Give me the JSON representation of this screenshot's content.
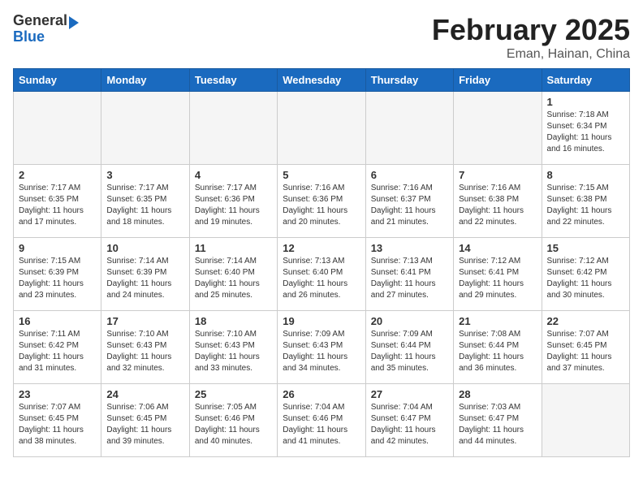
{
  "logo": {
    "line1": "General",
    "line2": "Blue"
  },
  "title": "February 2025",
  "subtitle": "Eman, Hainan, China",
  "days_of_week": [
    "Sunday",
    "Monday",
    "Tuesday",
    "Wednesday",
    "Thursday",
    "Friday",
    "Saturday"
  ],
  "weeks": [
    [
      {
        "day": "",
        "info": ""
      },
      {
        "day": "",
        "info": ""
      },
      {
        "day": "",
        "info": ""
      },
      {
        "day": "",
        "info": ""
      },
      {
        "day": "",
        "info": ""
      },
      {
        "day": "",
        "info": ""
      },
      {
        "day": "1",
        "info": "Sunrise: 7:18 AM\nSunset: 6:34 PM\nDaylight: 11 hours and 16 minutes."
      }
    ],
    [
      {
        "day": "2",
        "info": "Sunrise: 7:17 AM\nSunset: 6:35 PM\nDaylight: 11 hours and 17 minutes."
      },
      {
        "day": "3",
        "info": "Sunrise: 7:17 AM\nSunset: 6:35 PM\nDaylight: 11 hours and 18 minutes."
      },
      {
        "day": "4",
        "info": "Sunrise: 7:17 AM\nSunset: 6:36 PM\nDaylight: 11 hours and 19 minutes."
      },
      {
        "day": "5",
        "info": "Sunrise: 7:16 AM\nSunset: 6:36 PM\nDaylight: 11 hours and 20 minutes."
      },
      {
        "day": "6",
        "info": "Sunrise: 7:16 AM\nSunset: 6:37 PM\nDaylight: 11 hours and 21 minutes."
      },
      {
        "day": "7",
        "info": "Sunrise: 7:16 AM\nSunset: 6:38 PM\nDaylight: 11 hours and 22 minutes."
      },
      {
        "day": "8",
        "info": "Sunrise: 7:15 AM\nSunset: 6:38 PM\nDaylight: 11 hours and 22 minutes."
      }
    ],
    [
      {
        "day": "9",
        "info": "Sunrise: 7:15 AM\nSunset: 6:39 PM\nDaylight: 11 hours and 23 minutes."
      },
      {
        "day": "10",
        "info": "Sunrise: 7:14 AM\nSunset: 6:39 PM\nDaylight: 11 hours and 24 minutes."
      },
      {
        "day": "11",
        "info": "Sunrise: 7:14 AM\nSunset: 6:40 PM\nDaylight: 11 hours and 25 minutes."
      },
      {
        "day": "12",
        "info": "Sunrise: 7:13 AM\nSunset: 6:40 PM\nDaylight: 11 hours and 26 minutes."
      },
      {
        "day": "13",
        "info": "Sunrise: 7:13 AM\nSunset: 6:41 PM\nDaylight: 11 hours and 27 minutes."
      },
      {
        "day": "14",
        "info": "Sunrise: 7:12 AM\nSunset: 6:41 PM\nDaylight: 11 hours and 29 minutes."
      },
      {
        "day": "15",
        "info": "Sunrise: 7:12 AM\nSunset: 6:42 PM\nDaylight: 11 hours and 30 minutes."
      }
    ],
    [
      {
        "day": "16",
        "info": "Sunrise: 7:11 AM\nSunset: 6:42 PM\nDaylight: 11 hours and 31 minutes."
      },
      {
        "day": "17",
        "info": "Sunrise: 7:10 AM\nSunset: 6:43 PM\nDaylight: 11 hours and 32 minutes."
      },
      {
        "day": "18",
        "info": "Sunrise: 7:10 AM\nSunset: 6:43 PM\nDaylight: 11 hours and 33 minutes."
      },
      {
        "day": "19",
        "info": "Sunrise: 7:09 AM\nSunset: 6:43 PM\nDaylight: 11 hours and 34 minutes."
      },
      {
        "day": "20",
        "info": "Sunrise: 7:09 AM\nSunset: 6:44 PM\nDaylight: 11 hours and 35 minutes."
      },
      {
        "day": "21",
        "info": "Sunrise: 7:08 AM\nSunset: 6:44 PM\nDaylight: 11 hours and 36 minutes."
      },
      {
        "day": "22",
        "info": "Sunrise: 7:07 AM\nSunset: 6:45 PM\nDaylight: 11 hours and 37 minutes."
      }
    ],
    [
      {
        "day": "23",
        "info": "Sunrise: 7:07 AM\nSunset: 6:45 PM\nDaylight: 11 hours and 38 minutes."
      },
      {
        "day": "24",
        "info": "Sunrise: 7:06 AM\nSunset: 6:45 PM\nDaylight: 11 hours and 39 minutes."
      },
      {
        "day": "25",
        "info": "Sunrise: 7:05 AM\nSunset: 6:46 PM\nDaylight: 11 hours and 40 minutes."
      },
      {
        "day": "26",
        "info": "Sunrise: 7:04 AM\nSunset: 6:46 PM\nDaylight: 11 hours and 41 minutes."
      },
      {
        "day": "27",
        "info": "Sunrise: 7:04 AM\nSunset: 6:47 PM\nDaylight: 11 hours and 42 minutes."
      },
      {
        "day": "28",
        "info": "Sunrise: 7:03 AM\nSunset: 6:47 PM\nDaylight: 11 hours and 44 minutes."
      },
      {
        "day": "",
        "info": ""
      }
    ]
  ]
}
